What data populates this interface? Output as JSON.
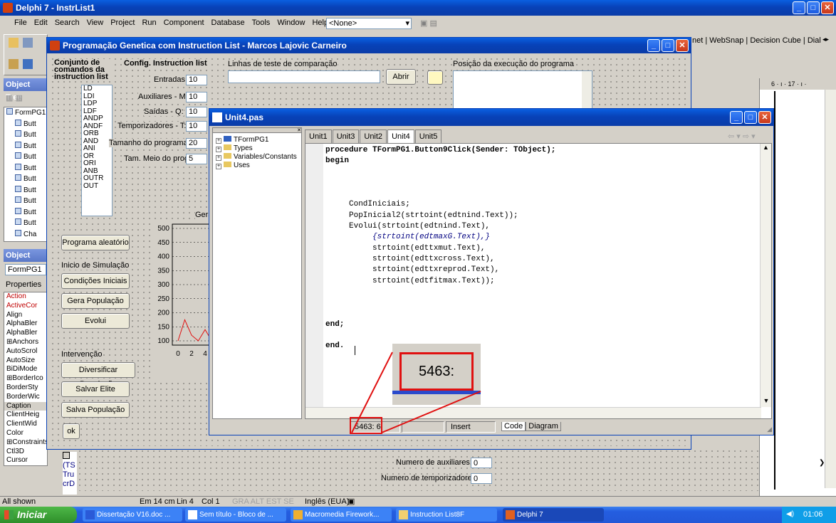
{
  "delphi": {
    "title": "Delphi 7 - InstrList1",
    "menu": [
      "File",
      "Edit",
      "Search",
      "View",
      "Project",
      "Run",
      "Component",
      "Database",
      "Tools",
      "Window",
      "Help"
    ],
    "combo_value": "<None>",
    "palette_tabs": "net | WebSnap | Decision Cube | Dial",
    "tree_title": "Object Tree",
    "tree_items": [
      "FormPG1",
      "Butt",
      "Butt",
      "Butt",
      "Butt",
      "Butt",
      "Butt",
      "Butt",
      "Butt",
      "Butt",
      "Butt",
      "Cha"
    ],
    "inspector_title": "Object Insp",
    "inspector_combo": "FormPG1",
    "inspector_tab": "Properties",
    "props": [
      "Action",
      "ActiveCor",
      "Align",
      "AlphaBler",
      "AlphaBler",
      "⊞Anchors",
      "AutoScrol",
      "AutoSize",
      "BiDiMode",
      "⊞BorderIco",
      "BorderSty",
      "BorderWic",
      "Caption",
      "ClientHeig",
      "ClientWid",
      "Color",
      "⊞Constraints",
      "Ctl3D",
      "Cursor"
    ],
    "prop_values": {
      "color": "",
      "constraints": "(TS",
      "ctl3d": "Tru",
      "cursor": "crD"
    },
    "status": {
      "all_shown": "All shown",
      "pos": "Em 14 cm",
      "lin": "Lin 4",
      "col": "Col 1",
      "lang": "Inglês (EUA)"
    },
    "ruler_label": "6 · ı · 17 · ı ·"
  },
  "form": {
    "title": "Programação Genetica com Instruction List - Marcos Lajovic Carneiro",
    "conj_label": "Conjunto de comandos da instruction list",
    "instructions": [
      "LD",
      "LDI",
      "LDP",
      "LDF",
      "ANDP",
      "ANDF",
      "ORB",
      "AND",
      "ANI",
      "OR",
      "ORI",
      "ANB",
      "OUTR",
      "OUT"
    ],
    "config_label": "Config. Instruction list",
    "fields": [
      {
        "label": "Entradas - I:",
        "value": "10"
      },
      {
        "label": "Auxiliares - M:",
        "value": "10"
      },
      {
        "label": "Saídas - Q:",
        "value": "10"
      },
      {
        "label": "Temporizadores - T:",
        "value": "10"
      },
      {
        "label": "Tamanho do programa:",
        "value": "20"
      },
      {
        "label": "Tam. Meio do prog.:",
        "value": "5"
      }
    ],
    "linhas_label": "Linhas de teste de comparação",
    "abrir": "Abrir",
    "posicao_label": "Posição da execução do programa",
    "gera_label": "Gera",
    "btn_aleatorio": "Programa aleatório",
    "inicio_label": "Inicio de Simulação",
    "btn_condicoes": "Condições Iniciais",
    "btn_gera": "Gera População",
    "btn_evolui": "Evolui",
    "intervencao_label": "Intervenção",
    "btn_diversificar": "Diversificar População",
    "btn_salvar": "Salvar Elite",
    "btn_salva": "Salva População",
    "btn_ok": "ok",
    "aux_label": "Numero de auxiliares:",
    "aux_value": "0",
    "temp_label": "Numero de temporizadores:",
    "temp_value": "0"
  },
  "chart_data": {
    "type": "line",
    "yticks": [
      "500",
      "450",
      "400",
      "350",
      "300",
      "250",
      "200",
      "150",
      "100"
    ],
    "xticks": [
      "0",
      "2",
      "4"
    ],
    "ylim": [
      100,
      500
    ],
    "series": [
      {
        "values": [
          100,
          175,
          120,
          100,
          140,
          100
        ]
      }
    ]
  },
  "unit": {
    "title": "Unit4.pas",
    "explorer": [
      "TFormPG1",
      "Types",
      "Variables/Constants",
      "Uses"
    ],
    "tabs": [
      "Unit1",
      "Unit3",
      "Unit2",
      "Unit4",
      "Unit5"
    ],
    "code": [
      {
        "t": "procedure TFormPG1.Button9Click(Sender: TObject);",
        "k": "bold"
      },
      {
        "t": "begin",
        "k": "bold"
      },
      {
        "t": "",
        "k": ""
      },
      {
        "t": "",
        "k": ""
      },
      {
        "t": "",
        "k": ""
      },
      {
        "t": "     CondIniciais;",
        "k": ""
      },
      {
        "t": "     PopInicial2(strtoint(edtnind.Text));",
        "k": ""
      },
      {
        "t": "     Evolui(strtoint(edtnind.Text),",
        "k": ""
      },
      {
        "t": "          {strtoint(edtmaxG.Text),}",
        "k": "comment"
      },
      {
        "t": "          strtoint(edttxmut.Text),",
        "k": ""
      },
      {
        "t": "          strtoint(edttxcross.Text),",
        "k": ""
      },
      {
        "t": "          strtoint(edttxreprod.Text),",
        "k": ""
      },
      {
        "t": "          strtoint(edtfitmax.Text));",
        "k": ""
      },
      {
        "t": "",
        "k": ""
      },
      {
        "t": "",
        "k": ""
      },
      {
        "t": "",
        "k": ""
      },
      {
        "t": "end;",
        "k": "bold"
      },
      {
        "t": "",
        "k": ""
      },
      {
        "t": "end.",
        "k": "bold"
      }
    ],
    "status_line": "5463:",
    "status_col": "6",
    "status_mode": "Insert",
    "tab_code": "Code",
    "tab_diagram": "Diagram",
    "zoom_text": "5463:"
  },
  "taskbar": {
    "start": "Iniciar",
    "items": [
      "Dissertação V16.doc ...",
      "Sem título - Bloco de ...",
      "Macromedia Firework...",
      "Instruction List8F",
      "Delphi 7"
    ],
    "clock": "01:06"
  }
}
